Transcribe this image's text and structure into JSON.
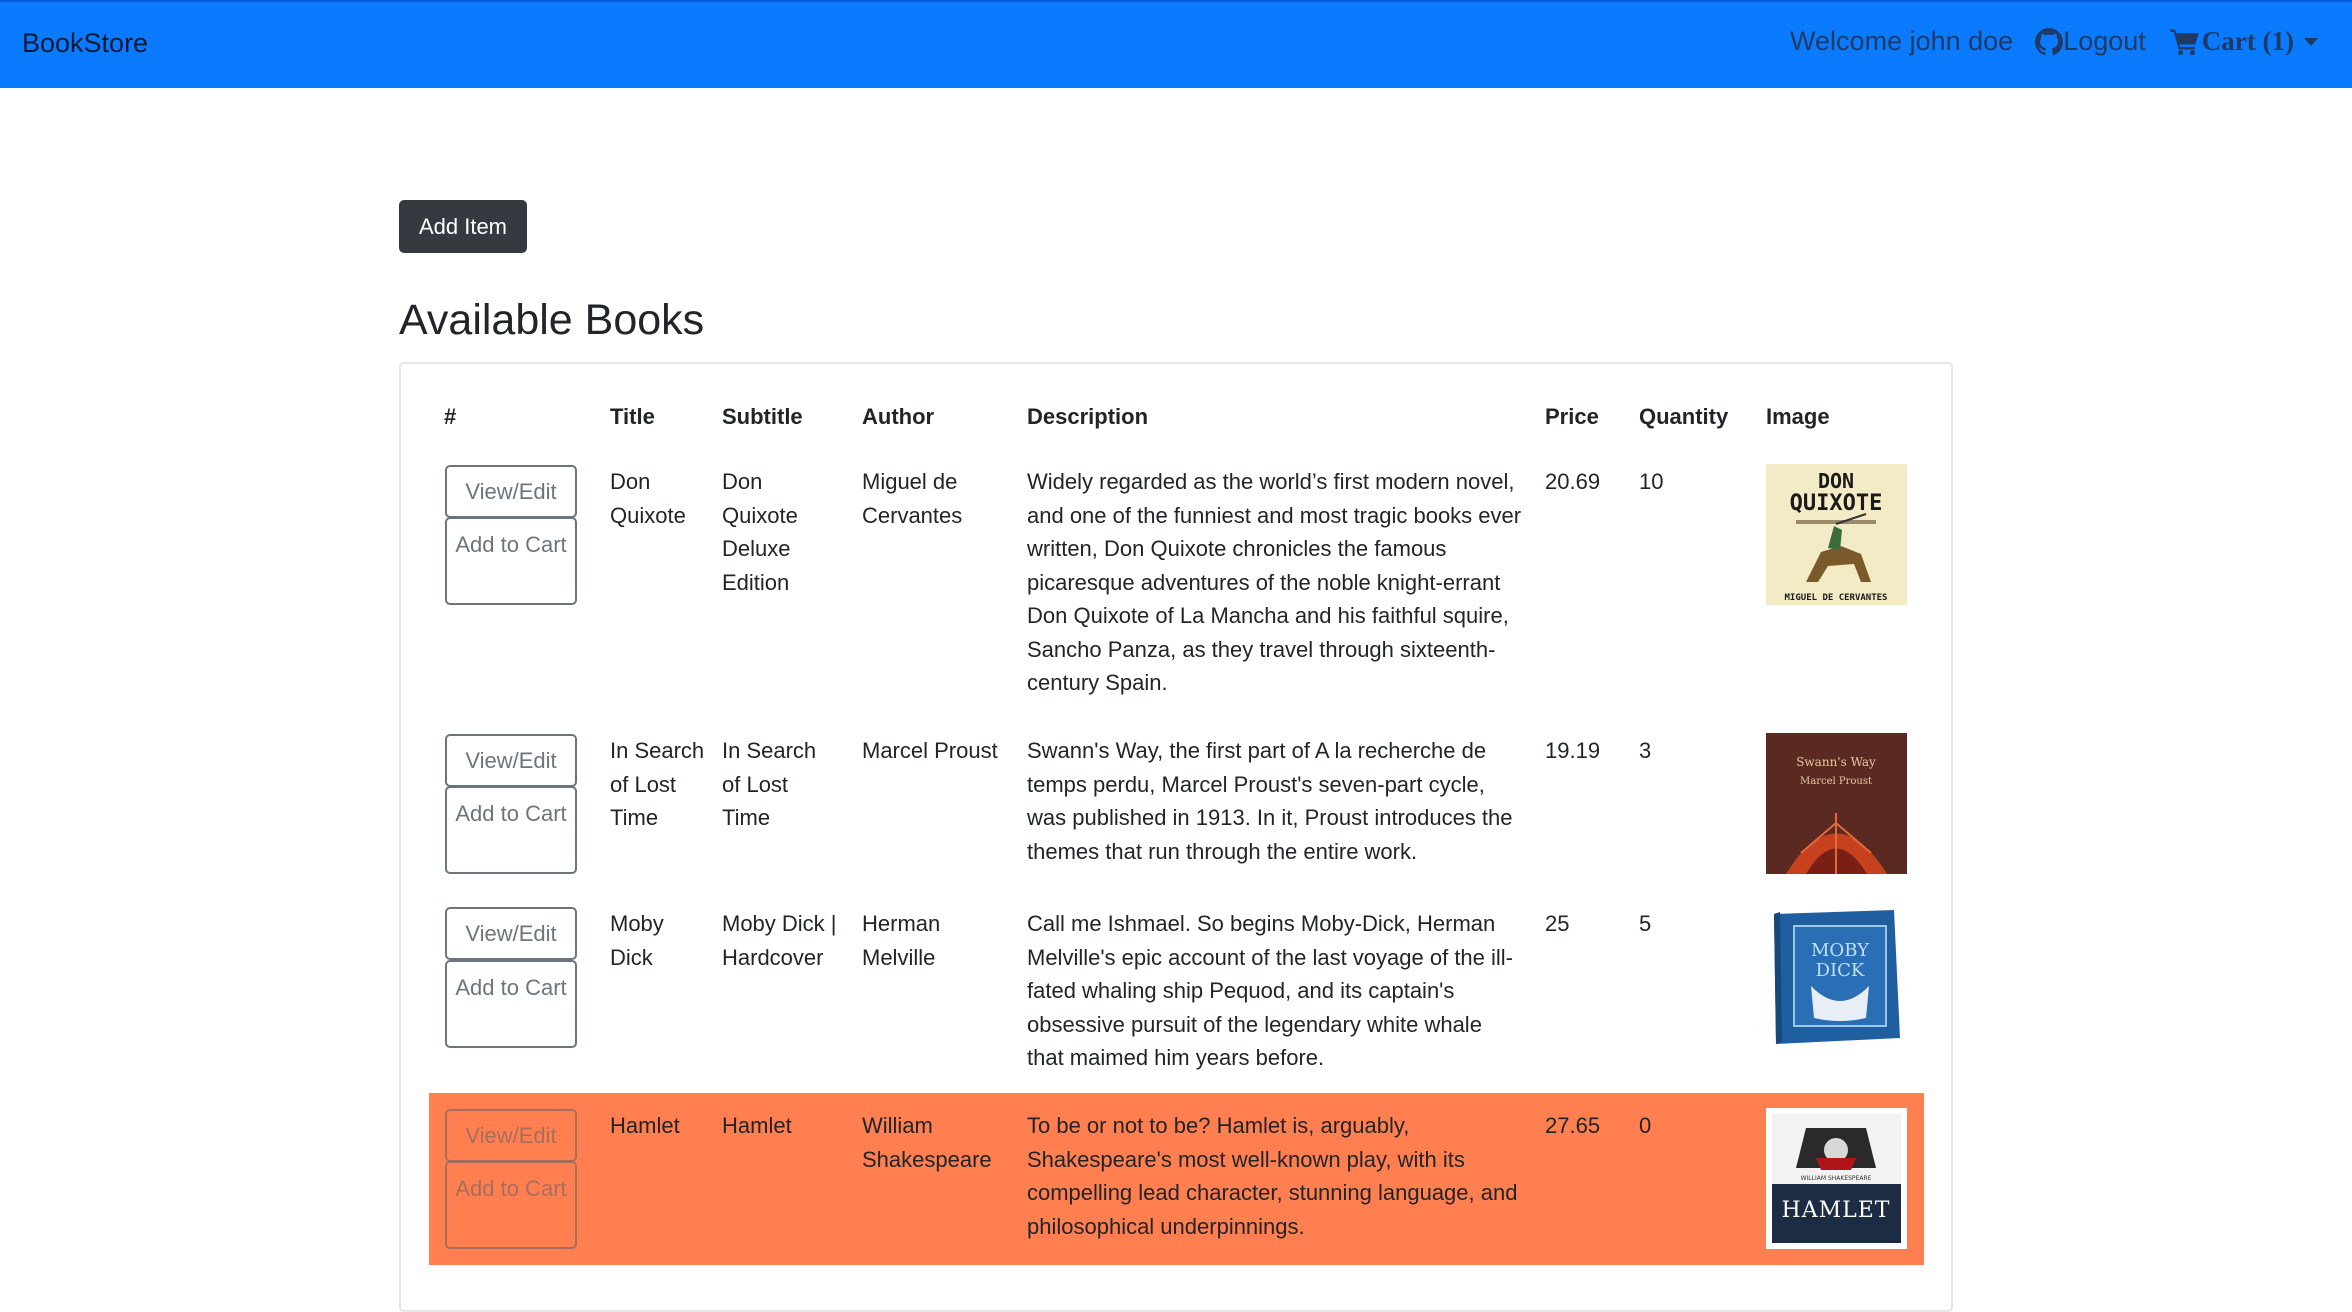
{
  "navbar": {
    "brand": "BookStore",
    "welcome": "Welcome john doe",
    "logout_label": "Logout",
    "cart_label": "Cart (1)"
  },
  "add_item_label": "Add Item",
  "page_title": "Available Books",
  "table": {
    "headers": [
      "#",
      "Title",
      "Subtitle",
      "Author",
      "Description",
      "Price",
      "Quantity",
      "Image"
    ],
    "view_edit_label": "View/Edit",
    "add_to_cart_label": "Add to Cart",
    "rows": [
      {
        "title": "Don Quixote",
        "subtitle": "Don Quixote Deluxe Edition",
        "author": "Miguel de Cervantes",
        "description": "Widely regarded as the world’s first modern novel, and one of the funniest and most tragic books ever written, Don Quixote chronicles the famous picaresque adventures of the noble knight-errant Don Quixote of La Mancha and his faithful squire, Sancho Panza, as they travel through sixteenth-century Spain.",
        "price": "20.69",
        "quantity": "10",
        "cover_text_top": "DON QUIXOTE",
        "cover_text_bottom": "MIGUEL DE CERVANTES",
        "highlighted": false
      },
      {
        "title": "In Search of Lost Time",
        "subtitle": "In Search of Lost Time",
        "author": "Marcel Proust",
        "description": "Swann's Way, the first part of A la recherche de temps perdu, Marcel Proust's seven-part cycle, was published in 1913. In it, Proust introduces the themes that run through the entire work.",
        "price": "19.19",
        "quantity": "3",
        "cover_text_top": "Swann's Way",
        "cover_text_bottom": "Marcel Proust",
        "highlighted": false
      },
      {
        "title": "Moby Dick",
        "subtitle": "Moby Dick | Hardcover",
        "author": "Herman Melville",
        "description": "Call me Ishmael. So begins Moby-Dick, Herman Melville's epic account of the last voyage of the ill-fated whaling ship Pequod, and its captain's obsessive pursuit of the legendary white whale that maimed him years before.",
        "price": "25",
        "quantity": "5",
        "cover_text_top": "MOBY DICK",
        "cover_text_bottom": "",
        "highlighted": false
      },
      {
        "title": "Hamlet",
        "subtitle": "Hamlet",
        "author": "William Shakespeare",
        "description": "To be or not to be? Hamlet is, arguably, Shakespeare's most well-known play, with its compelling lead character, stunning language, and philosophical underpinnings.",
        "price": "27.65",
        "quantity": "0",
        "cover_text_top": "WILLIAM SHAKESPEARE",
        "cover_text_bottom": "HAMLET",
        "highlighted": true
      }
    ]
  },
  "colors": {
    "navbar": "#0a7bff",
    "highlight_row": "#ff7f50",
    "dark_button": "#343a40"
  }
}
